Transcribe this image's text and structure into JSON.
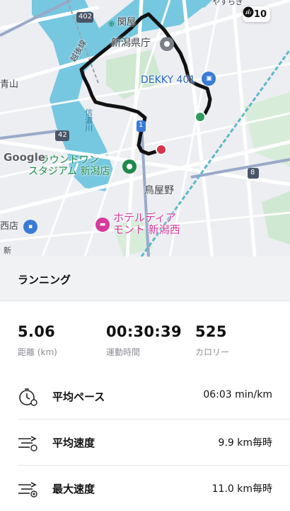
{
  "map": {
    "labels": {
      "station": "関屋",
      "prefecture_office": "新潟県庁",
      "dekky": "DEKKY 401",
      "round_one": "ラウンドワン\nスタジアム 新潟店",
      "toriyano": "鳥屋野",
      "hotel": "ホテルディア\nモント 新潟西",
      "aoyama": "青山",
      "shoten": "西店",
      "etsugo_line": "越後線",
      "shinano_river": "信濃川",
      "top_right": "やすらぎ",
      "shin": "新",
      "route_402": "402",
      "route_42": "42",
      "route_1": "1",
      "route_8": "8"
    },
    "google_logo": "Google",
    "level_badge": "+10",
    "route_color": "#111111",
    "start_color": "#2e9e5b",
    "end_color": "#d6334a"
  },
  "activity": {
    "title": "ランニング"
  },
  "stats": [
    {
      "value": "5.06",
      "label": "距離 (km)"
    },
    {
      "value": "00:30:39",
      "label": "運動時間"
    },
    {
      "value": "525",
      "label": "カロリー"
    }
  ],
  "metrics": [
    {
      "name": "平均ペース",
      "value": "06:03 min/km",
      "icon": "stopwatch-icon"
    },
    {
      "name": "平均速度",
      "value": "9.9 km毎時",
      "icon": "speed-average-icon"
    },
    {
      "name": "最大速度",
      "value": "11.0 km毎時",
      "icon": "speed-max-icon"
    }
  ]
}
